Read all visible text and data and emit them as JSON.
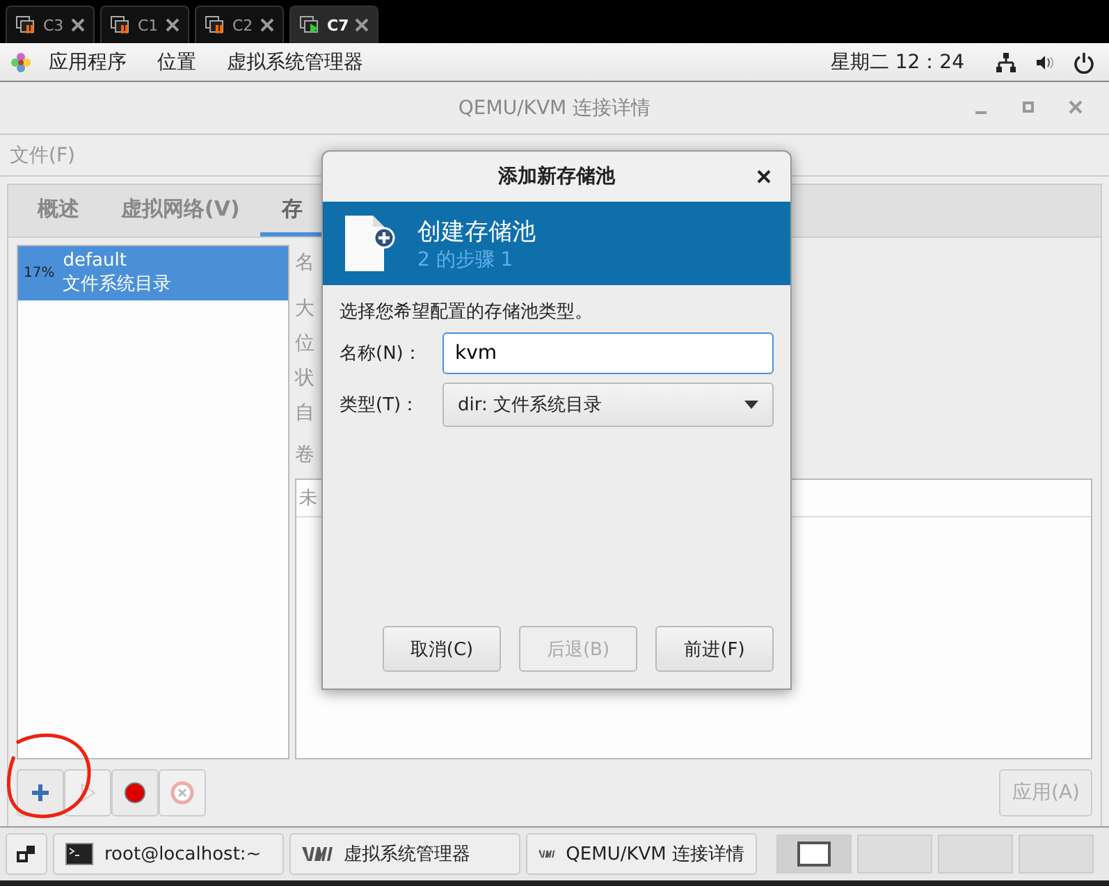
{
  "vm_tabs": [
    {
      "label": "C3",
      "running": false,
      "selected": false
    },
    {
      "label": "C1",
      "running": false,
      "selected": false
    },
    {
      "label": "C2",
      "running": false,
      "selected": false
    },
    {
      "label": "C7",
      "running": true,
      "selected": true
    }
  ],
  "top_bar": {
    "menus": [
      "应用程序",
      "位置",
      "虚拟系统管理器"
    ],
    "clock": "星期二 12：24"
  },
  "window": {
    "title": "QEMU/KVM 连接详情"
  },
  "menu": [
    "文件(F)"
  ],
  "tabs": [
    {
      "label": "概述",
      "selected": false
    },
    {
      "label": "虚拟网络(V)",
      "selected": false
    },
    {
      "label": "存",
      "selected": true
    }
  ],
  "pools": [
    {
      "usage": "17%",
      "name": "default",
      "type": "文件系统目录",
      "selected": true
    }
  ],
  "detail_labels": [
    "名",
    "大",
    "位",
    "状",
    "自"
  ],
  "volumes_label": "卷",
  "volumes_column": "未",
  "pool_buttons": [
    {
      "kind": "add",
      "disabled": false
    },
    {
      "kind": "start",
      "disabled": true
    },
    {
      "kind": "stop",
      "disabled": false
    },
    {
      "kind": "delete",
      "disabled": true
    }
  ],
  "apply_button": {
    "label": "应用(A)",
    "disabled": true
  },
  "dialog": {
    "title": "添加新存储池",
    "header_title": "创建存储池",
    "header_step": "2 的步骤 1",
    "prompt": "选择您希望配置的存储池类型。",
    "fields": [
      {
        "kind": "text",
        "label": "名称(N)：",
        "value": "kvm"
      },
      {
        "kind": "select",
        "label": "类型(T)：",
        "value": "dir: 文件系统目录"
      }
    ],
    "buttons": [
      {
        "label": "取消(C)",
        "disabled": false
      },
      {
        "label": "后退(B)",
        "disabled": true
      },
      {
        "label": "前进(F)",
        "disabled": false
      }
    ]
  },
  "taskbar": [
    {
      "kind": "terminal",
      "label": "root@localhost:~"
    },
    {
      "kind": "vm",
      "label": "虚拟系统管理器"
    },
    {
      "kind": "vm",
      "label": "QEMU/KVM 连接详情"
    }
  ],
  "workspaces": [
    {
      "selected": true
    },
    {
      "selected": false
    },
    {
      "selected": false
    },
    {
      "selected": false
    }
  ]
}
